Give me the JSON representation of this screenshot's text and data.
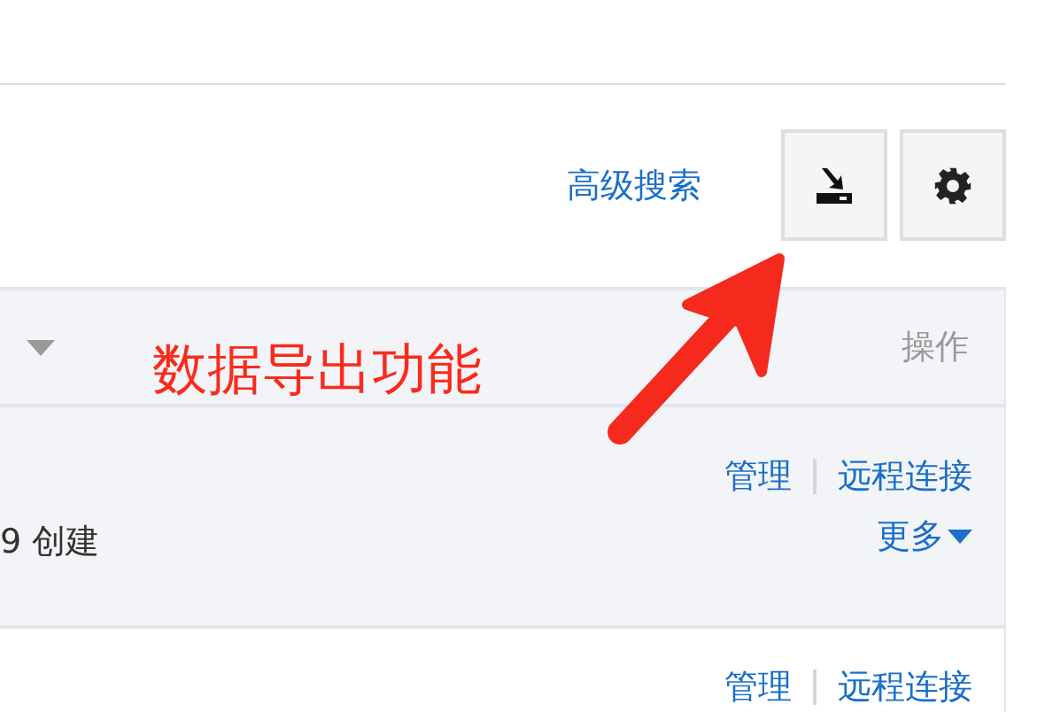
{
  "toolbar": {
    "advanced_search": "高级搜索"
  },
  "table": {
    "columns": [
      {
        "label": "操作"
      }
    ],
    "rows": [
      {
        "highlighted": true,
        "column_1": "9 创建",
        "actions": [
          "管理",
          "远程连接"
        ],
        "more": "更多"
      },
      {
        "highlighted": false,
        "actions": [
          "管理",
          "远程连接"
        ]
      }
    ]
  },
  "annotation": {
    "text": "数据导出功能"
  }
}
